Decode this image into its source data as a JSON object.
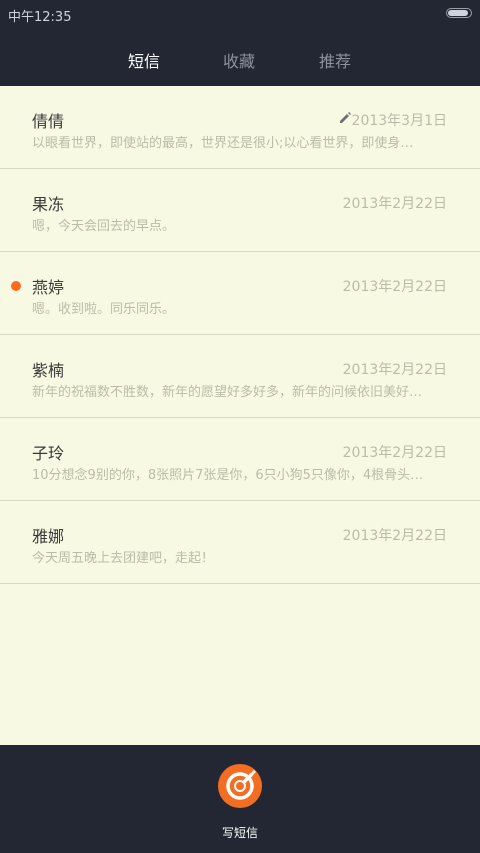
{
  "status_bar": {
    "time": "中午12:35",
    "battery_level": 0.9
  },
  "tabs": [
    {
      "label": "短信",
      "active": true
    },
    {
      "label": "收藏",
      "active": false
    },
    {
      "label": "推荐",
      "active": false
    }
  ],
  "conversations": [
    {
      "name": "倩倩",
      "date": "2013年3月1日",
      "preview": "以眼看世界，即使站的最高，世界还是很小;以心看世界，即使身…",
      "unread": false,
      "draft_icon": "pencil-icon"
    },
    {
      "name": "果冻",
      "date": "2013年2月22日",
      "preview": "嗯，今天会回去的早点。",
      "unread": false
    },
    {
      "name": "燕婷",
      "date": "2013年2月22日",
      "preview": "嗯。收到啦。同乐同乐。",
      "unread": true
    },
    {
      "name": "紫楠",
      "date": "2013年2月22日",
      "preview": "新年的祝福数不胜数，新年的愿望好多好多，新年的问候依旧美好…",
      "unread": false
    },
    {
      "name": "子玲",
      "date": "2013年2月22日",
      "preview": "10分想念9别的你，8张照片7张是你，6只小狗5只像你，4根骨头…",
      "unread": false
    },
    {
      "name": "雅娜",
      "date": "2013年2月22日",
      "preview": "今天周五晚上去团建吧，走起！",
      "unread": false
    }
  ],
  "compose": {
    "label": "写短信",
    "icon": "compose-icon"
  },
  "colors": {
    "accent": "#f36e23",
    "unread_dot": "#ff6a1f",
    "header_bg": "#232734",
    "list_bg": "#f8f9e3"
  }
}
